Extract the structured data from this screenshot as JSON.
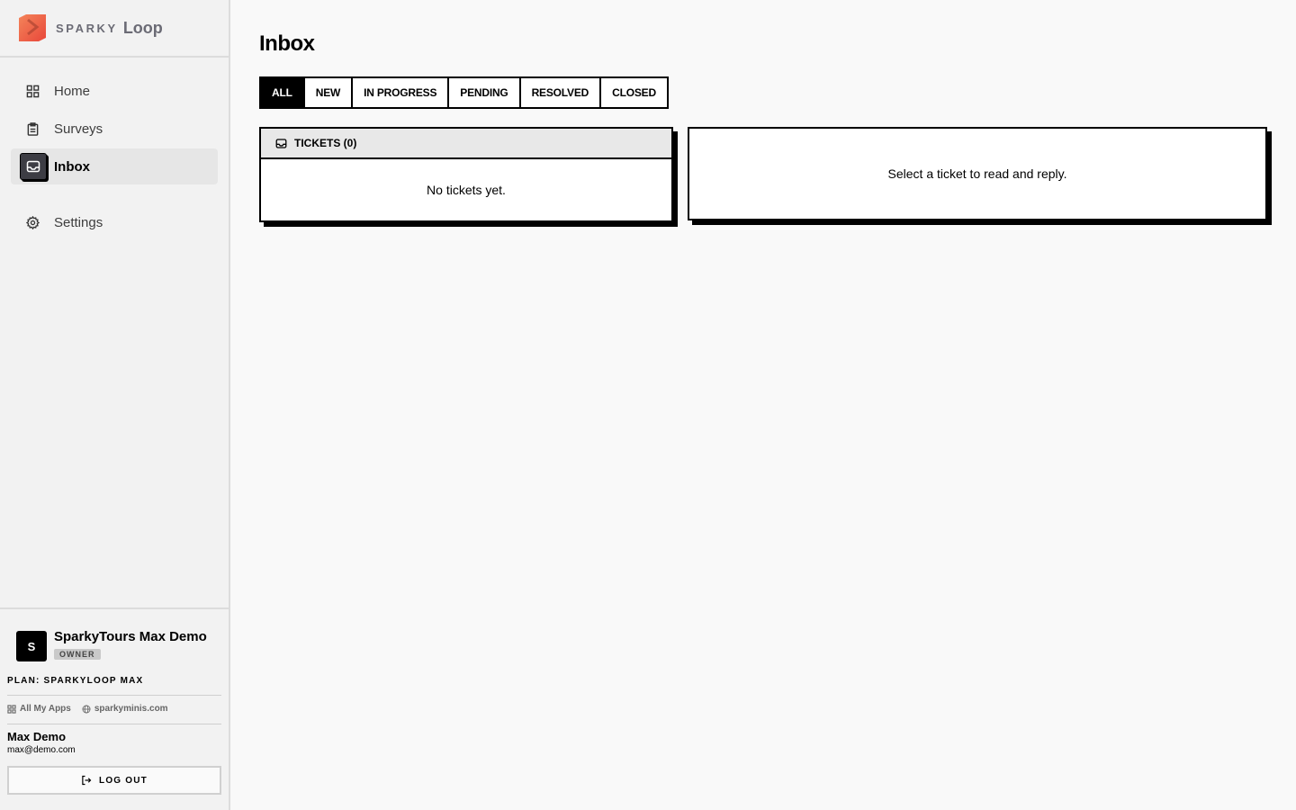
{
  "brand": {
    "word1": "SPARKY",
    "word2": "Loop"
  },
  "nav": {
    "items": [
      {
        "label": "Home",
        "icon": "grid-icon"
      },
      {
        "label": "Surveys",
        "icon": "clipboard-icon"
      },
      {
        "label": "Inbox",
        "icon": "inbox-icon",
        "active": true
      },
      {
        "label": "Settings",
        "icon": "gear-icon"
      }
    ]
  },
  "org": {
    "avatar": "S",
    "name": "SparkyTours Max Demo",
    "role": "OWNER"
  },
  "plan": "PLAN: SPARKYLOOP MAX",
  "links": {
    "apps": "All My Apps",
    "site": "sparkyminis.com"
  },
  "user": {
    "name": "Max Demo",
    "email": "max@demo.com"
  },
  "logout_label": "LOG OUT",
  "page": {
    "title": "Inbox"
  },
  "tabs": [
    "ALL",
    "NEW",
    "IN PROGRESS",
    "PENDING",
    "RESOLVED",
    "CLOSED"
  ],
  "tickets": {
    "header": "TICKETS (0)",
    "empty": "No tickets yet."
  },
  "detail": {
    "empty": "Select a ticket to read and reply."
  },
  "colors": {
    "accent": "#000000",
    "brand_orange": "#f0643c",
    "sidebar_bg": "#f2f2f2"
  }
}
